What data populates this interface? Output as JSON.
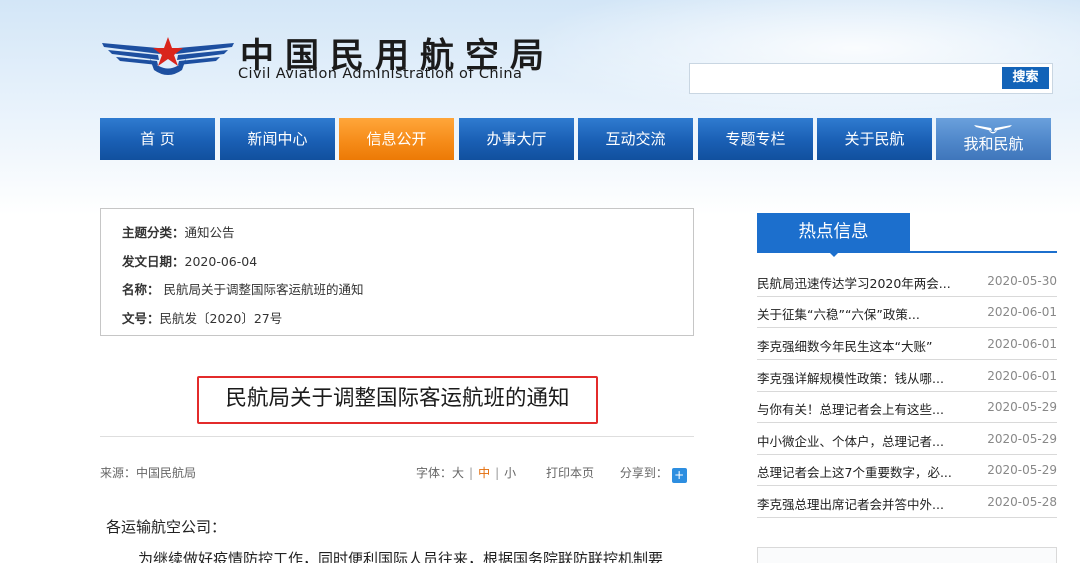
{
  "header": {
    "title_cn": "中国民用航空局",
    "title_en": "Civil Aviation Administration of China",
    "search": {
      "value": "",
      "placeholder": "",
      "button_label": "搜索"
    }
  },
  "nav": {
    "items": [
      {
        "label": "首 页"
      },
      {
        "label": "新闻中心"
      },
      {
        "label": "信息公开"
      },
      {
        "label": "办事大厅"
      },
      {
        "label": "互动交流"
      },
      {
        "label": "专题专栏"
      },
      {
        "label": "关于民航"
      },
      {
        "label": "我和民航"
      }
    ],
    "active_label": "信息公开",
    "colors": {
      "nav_blue": "#1a5fb4",
      "nav_active_orange": "#f58a17",
      "accent_red": "#e32b2b"
    }
  },
  "info": {
    "category_label": "主题分类：",
    "category_value": "通知公告",
    "date_label": "发文日期：",
    "date_value": "2020-06-04",
    "name_label": "名称：",
    "name_value": "民航局关于调整国际客运航班的通知",
    "doc_label": "文号：",
    "doc_value": "民航发〔2020〕27号"
  },
  "article": {
    "title": "民航局关于调整国际客运航班的通知",
    "source": "来源：中国民航局",
    "font_label": "字体：",
    "font_large": "大",
    "font_medium": "中",
    "font_small": "小",
    "print_label": "打印本页",
    "share_label": "分享到：",
    "greeting": "各运输航空公司：",
    "paragraph": "为继续做好疫情防控工作，同时便利国际人员往来，根据国务院联防联控机制要"
  },
  "hot": {
    "heading": "热点信息",
    "items": [
      {
        "title": "民航局迅速传达学习2020年两会...",
        "date": "2020-05-30"
      },
      {
        "title": "关于征集“六稳”“六保”政策...",
        "date": "2020-06-01"
      },
      {
        "title": "李克强细数今年民生这本“大账”",
        "date": "2020-06-01"
      },
      {
        "title": "李克强详解规模性政策：钱从哪...",
        "date": "2020-06-01"
      },
      {
        "title": "与你有关！总理记者会上有这些...",
        "date": "2020-05-29"
      },
      {
        "title": "中小微企业、个体户，总理记者...",
        "date": "2020-05-29"
      },
      {
        "title": "总理记者会上这7个重要数字，必...",
        "date": "2020-05-29"
      },
      {
        "title": "李克强总理出席记者会并答中外...",
        "date": "2020-05-28"
      }
    ]
  }
}
